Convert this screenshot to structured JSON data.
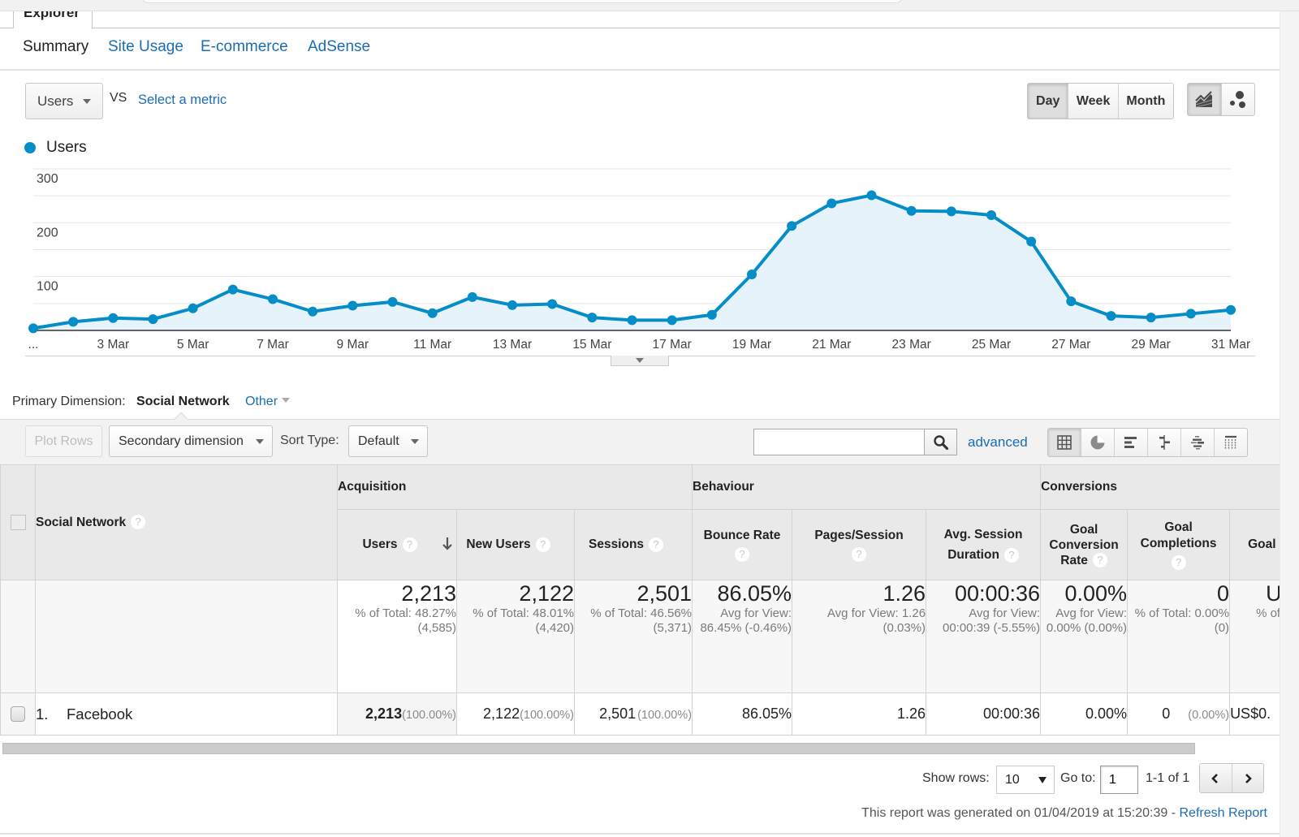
{
  "top_tab": {
    "label": "Explorer"
  },
  "subtabs": [
    {
      "label": "Summary",
      "active": true
    },
    {
      "label": "Site Usage",
      "active": false
    },
    {
      "label": "E-commerce",
      "active": false
    },
    {
      "label": "AdSense",
      "active": false
    }
  ],
  "metric_selector": {
    "value": "Users",
    "vs_label": "VS",
    "select_metric_label": "Select a metric"
  },
  "time_granularity": [
    {
      "label": "Day",
      "active": true
    },
    {
      "label": "Week",
      "active": false
    },
    {
      "label": "Month",
      "active": false
    }
  ],
  "chart_type_buttons": [
    {
      "icon": "line-chart-icon",
      "active": true
    },
    {
      "icon": "motion-chart-icon",
      "active": false
    }
  ],
  "colors": {
    "series": "#058dc7",
    "area_fill": "#e6f3fa",
    "link": "#1a6db3"
  },
  "chart_data": {
    "type": "area",
    "title": "",
    "xlabel": "",
    "ylabel": "",
    "legend": [
      {
        "name": "Users",
        "color": "#058dc7"
      }
    ],
    "legend_position": "top-left",
    "categories": [
      "1 Mar",
      "2 Mar",
      "3 Mar",
      "4 Mar",
      "5 Mar",
      "6 Mar",
      "7 Mar",
      "8 Mar",
      "9 Mar",
      "10 Mar",
      "11 Mar",
      "12 Mar",
      "13 Mar",
      "14 Mar",
      "15 Mar",
      "16 Mar",
      "17 Mar",
      "18 Mar",
      "19 Mar",
      "20 Mar",
      "21 Mar",
      "22 Mar",
      "23 Mar",
      "24 Mar",
      "25 Mar",
      "26 Mar",
      "27 Mar",
      "28 Mar",
      "29 Mar",
      "30 Mar",
      "31 Mar"
    ],
    "series": [
      {
        "name": "Users",
        "color": "#058dc7",
        "values": [
          4,
          16,
          23,
          21,
          41,
          76,
          58,
          35,
          46,
          53,
          32,
          62,
          47,
          49,
          24,
          19,
          19,
          29,
          104,
          194,
          236,
          251,
          222,
          221,
          214,
          165,
          54,
          27,
          24,
          31,
          38
        ]
      }
    ],
    "x_ticks": [
      {
        "label": "...",
        "at": "1 Mar"
      },
      {
        "label": "3 Mar",
        "at": "3 Mar"
      },
      {
        "label": "5 Mar",
        "at": "5 Mar"
      },
      {
        "label": "7 Mar",
        "at": "7 Mar"
      },
      {
        "label": "9 Mar",
        "at": "9 Mar"
      },
      {
        "label": "11 Mar",
        "at": "11 Mar"
      },
      {
        "label": "13 Mar",
        "at": "13 Mar"
      },
      {
        "label": "15 Mar",
        "at": "15 Mar"
      },
      {
        "label": "17 Mar",
        "at": "17 Mar"
      },
      {
        "label": "19 Mar",
        "at": "19 Mar"
      },
      {
        "label": "21 Mar",
        "at": "21 Mar"
      },
      {
        "label": "23 Mar",
        "at": "23 Mar"
      },
      {
        "label": "25 Mar",
        "at": "25 Mar"
      },
      {
        "label": "27 Mar",
        "at": "27 Mar"
      },
      {
        "label": "29 Mar",
        "at": "29 Mar"
      },
      {
        "label": "31 Mar",
        "at": "31 Mar"
      }
    ],
    "y_ticks": [
      100,
      200,
      300
    ],
    "ylim": [
      0,
      300
    ],
    "grid": true,
    "grid_step": 50
  },
  "primary_dimension": {
    "label": "Primary Dimension:",
    "value": "Social Network",
    "other_label": "Other"
  },
  "toolbar": {
    "plot_rows_label": "Plot Rows",
    "secondary_dimension_label": "Secondary dimension",
    "sort_type_label": "Sort Type:",
    "sort_type_value": "Default",
    "search_value": "",
    "search_placeholder": "",
    "advanced_label": "advanced",
    "views": [
      {
        "icon": "table-view-icon",
        "active": true
      },
      {
        "icon": "percentage-view-icon",
        "active": false
      },
      {
        "icon": "performance-view-icon",
        "active": false
      },
      {
        "icon": "comparison-view-icon",
        "active": false
      },
      {
        "icon": "term-cloud-view-icon",
        "active": false
      },
      {
        "icon": "pivot-view-icon",
        "active": false
      }
    ]
  },
  "table": {
    "dimension_header": "Social Network",
    "groups": [
      {
        "label": "Acquisition"
      },
      {
        "label": "Behaviour"
      },
      {
        "label": "Conversions"
      }
    ],
    "columns": [
      {
        "label": "Users",
        "sorted": "descending"
      },
      {
        "label": "New Users"
      },
      {
        "label": "Sessions"
      },
      {
        "label": "Bounce Rate"
      },
      {
        "label": "Pages/Session"
      },
      {
        "label": "Avg. Session Duration"
      },
      {
        "label": "Goal Conversion Rate"
      },
      {
        "label": "Goal Completions"
      },
      {
        "label": "Goal Value"
      }
    ],
    "totals": [
      {
        "value": "2,213",
        "sub": "% of Total: 48.27% (4,585)"
      },
      {
        "value": "2,122",
        "sub": "% of Total: 48.01% (4,420)"
      },
      {
        "value": "2,501",
        "sub": "% of Total: 46.56% (5,371)"
      },
      {
        "value": "86.05%",
        "sub": "Avg for View: 86.45% (-0.46%)"
      },
      {
        "value": "1.26",
        "sub": "Avg for View: 1.26 (0.03%)"
      },
      {
        "value": "00:00:36",
        "sub": "Avg for View: 00:00:39 (-5.55%)"
      },
      {
        "value": "0.00%",
        "sub": "Avg for View: 0.00% (0.00%)"
      },
      {
        "value": "0",
        "sub": "% of Total: 0.00% (0)"
      },
      {
        "value": "U",
        "sub": "% of"
      }
    ],
    "rows": [
      {
        "index": "1.",
        "name": "Facebook",
        "cells": [
          {
            "value": "2,213",
            "pct": "(100.00%)"
          },
          {
            "value": "2,122",
            "pct": "(100.00%)"
          },
          {
            "value": "2,501",
            "pct": "(100.00%)"
          },
          {
            "value": "86.05%"
          },
          {
            "value": "1.26"
          },
          {
            "value": "00:00:36"
          },
          {
            "value": "0.00%"
          },
          {
            "value": "0",
            "pct": "(0.00%)"
          },
          {
            "value": "US$0."
          }
        ]
      }
    ]
  },
  "pagination": {
    "show_rows_label": "Show rows:",
    "show_rows_value": "10",
    "goto_label": "Go to:",
    "goto_value": "1",
    "range_text": "1-1 of 1"
  },
  "footer": {
    "generated_text": "This report was generated on 01/04/2019 at 15:20:39 - ",
    "refresh_label": "Refresh Report"
  }
}
